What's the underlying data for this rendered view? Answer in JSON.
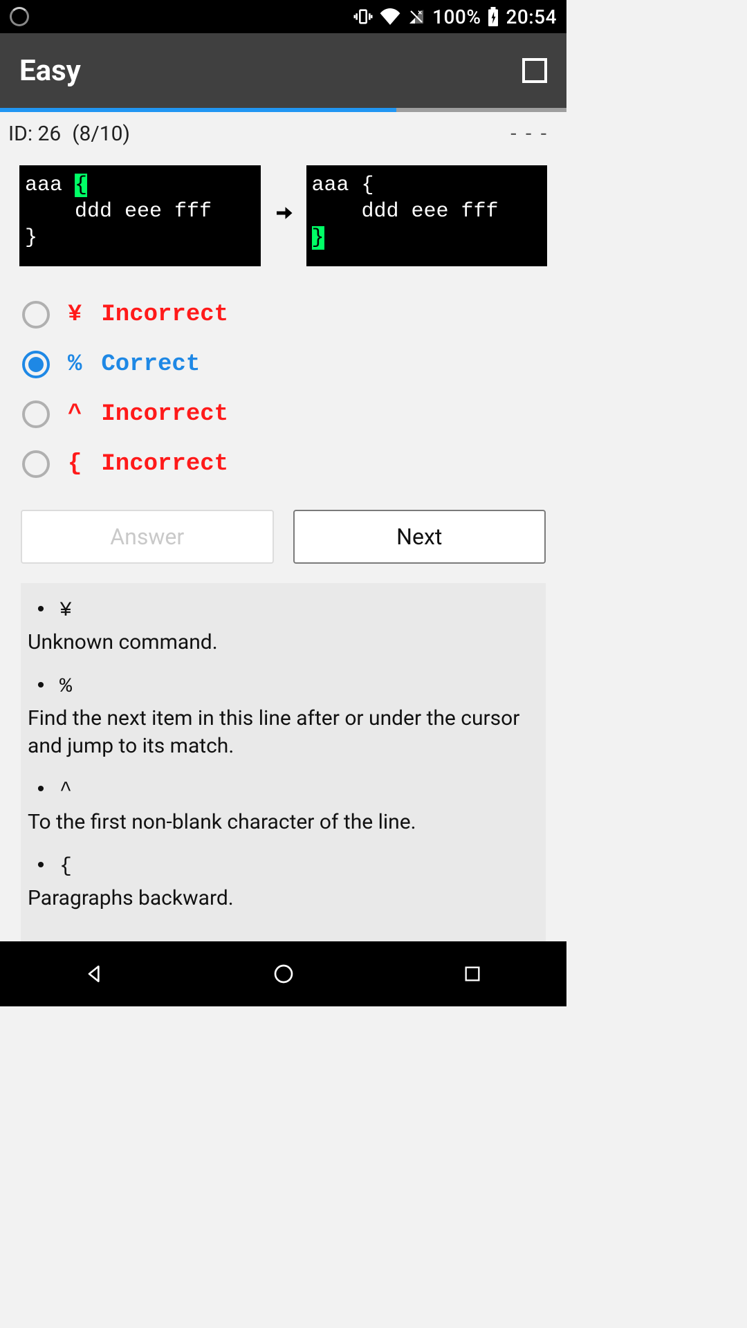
{
  "status": {
    "battery_pct": "100%",
    "clock": "20:54"
  },
  "appbar": {
    "title": "Easy"
  },
  "progress_pct": 70,
  "info": {
    "id_label": "ID: 26",
    "counter": "(8/10)",
    "menu": "- - -"
  },
  "code": {
    "before_pre": "aaa ",
    "before_cur": "{",
    "before_post": "\n    ddd eee fff\n}",
    "after_pre": "aaa {\n    ddd eee fff\n",
    "after_cur": "}",
    "after_post": ""
  },
  "options": [
    {
      "key": "¥",
      "status": "Incorrect",
      "selected": false,
      "correct": false
    },
    {
      "key": "%",
      "status": "Correct",
      "selected": true,
      "correct": true
    },
    {
      "key": "^",
      "status": "Incorrect",
      "selected": false,
      "correct": false
    },
    {
      "key": "{",
      "status": "Incorrect",
      "selected": false,
      "correct": false
    }
  ],
  "buttons": {
    "answer": "Answer",
    "next": "Next"
  },
  "explanations": [
    {
      "key": "¥",
      "text": "Unknown command."
    },
    {
      "key": "%",
      "text": "Find the next item in this line after or under the cursor and jump to its match."
    },
    {
      "key": "^",
      "text": "To the first non-blank character of the line."
    },
    {
      "key": "{",
      "text": "Paragraphs backward."
    }
  ]
}
